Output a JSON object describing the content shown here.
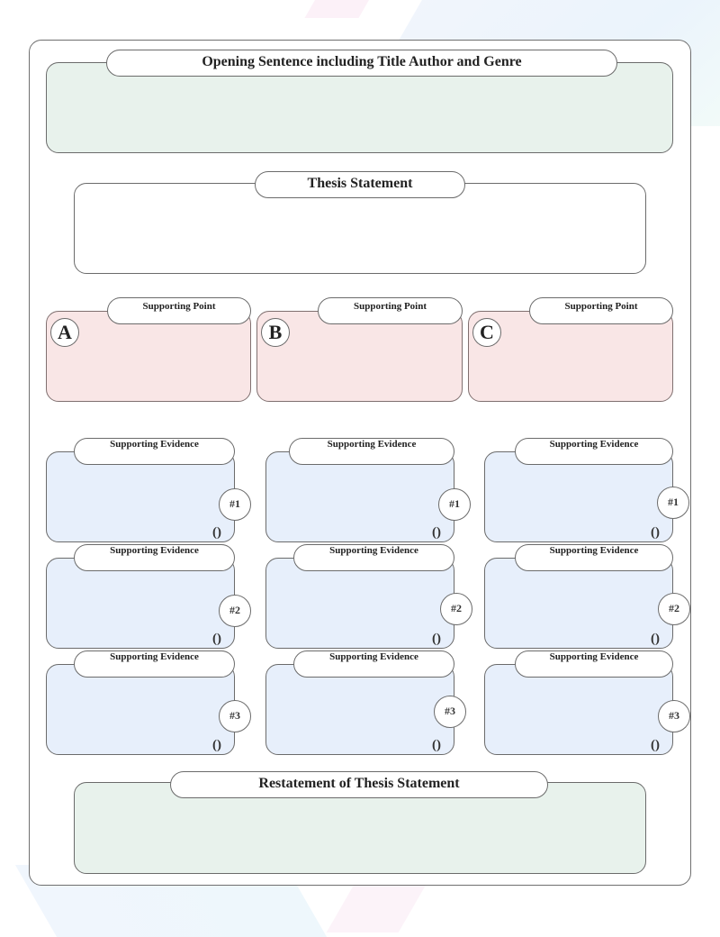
{
  "opening": {
    "label": "Opening Sentence including Title Author and Genre"
  },
  "thesis": {
    "label": "Thesis Statement"
  },
  "supporting_points": [
    {
      "letter": "A",
      "label": "Supporting Point"
    },
    {
      "letter": "B",
      "label": "Supporting Point"
    },
    {
      "letter": "C",
      "label": "Supporting Point"
    }
  ],
  "evidence_columns": [
    {
      "items": [
        {
          "label": "Supporting Evidence",
          "number": "#1",
          "paren": "()"
        },
        {
          "label": "Supporting Evidence",
          "number": "#2",
          "paren": "()"
        },
        {
          "label": "Supporting Evidence",
          "number": "#3",
          "paren": "()"
        }
      ]
    },
    {
      "items": [
        {
          "label": "Supporting Evidence",
          "number": "#1",
          "paren": "()"
        },
        {
          "label": "Supporting Evidence",
          "number": "#2",
          "paren": "()"
        },
        {
          "label": "Supporting Evidence",
          "number": "#3",
          "paren": "()"
        }
      ]
    },
    {
      "items": [
        {
          "label": "Supporting Evidence",
          "number": "#1",
          "paren": "()"
        },
        {
          "label": "Supporting Evidence",
          "number": "#2",
          "paren": "()"
        },
        {
          "label": "Supporting Evidence",
          "number": "#3",
          "paren": "()"
        }
      ]
    }
  ],
  "restatement": {
    "label": "Restatement of Thesis Statement"
  },
  "colors": {
    "opening_fill": "#e8f2ec",
    "point_fill": "#f9e6e6",
    "evidence_fill": "#e7effb",
    "restatement_fill": "#e8f2ec",
    "border": "#6b6b6b"
  }
}
